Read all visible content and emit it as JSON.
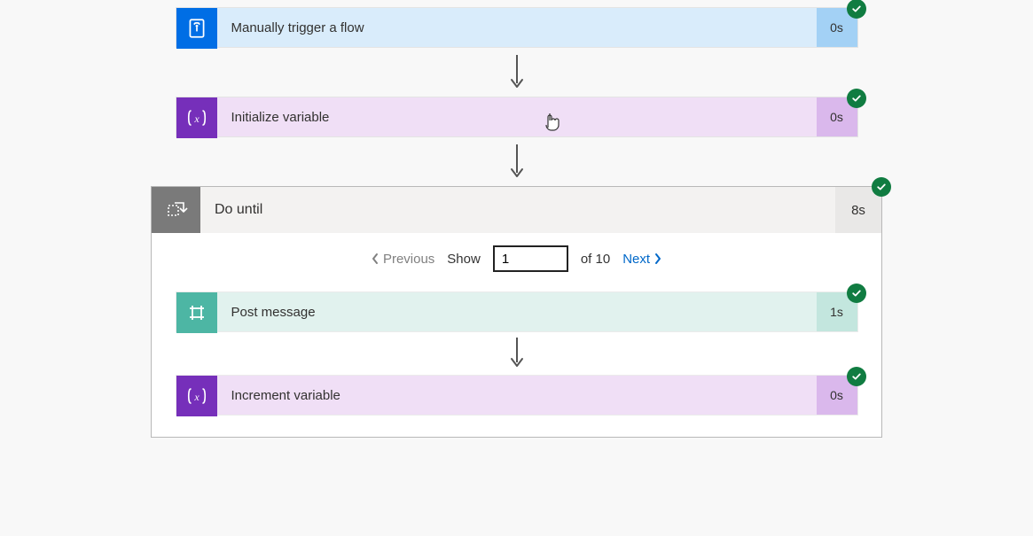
{
  "flow": {
    "steps": [
      {
        "label": "Manually trigger a flow",
        "duration": "0s",
        "kind": "trigger"
      },
      {
        "label": "Initialize variable",
        "duration": "0s",
        "kind": "variable"
      }
    ],
    "loop": {
      "title": "Do until",
      "duration": "8s",
      "pager": {
        "previous_label": "Previous",
        "show_label": "Show",
        "value": "1",
        "of_label": "of 10",
        "next_label": "Next"
      },
      "steps": [
        {
          "label": "Post message",
          "duration": "1s",
          "kind": "postmsg"
        },
        {
          "label": "Increment variable",
          "duration": "0s",
          "kind": "variable"
        }
      ]
    }
  }
}
